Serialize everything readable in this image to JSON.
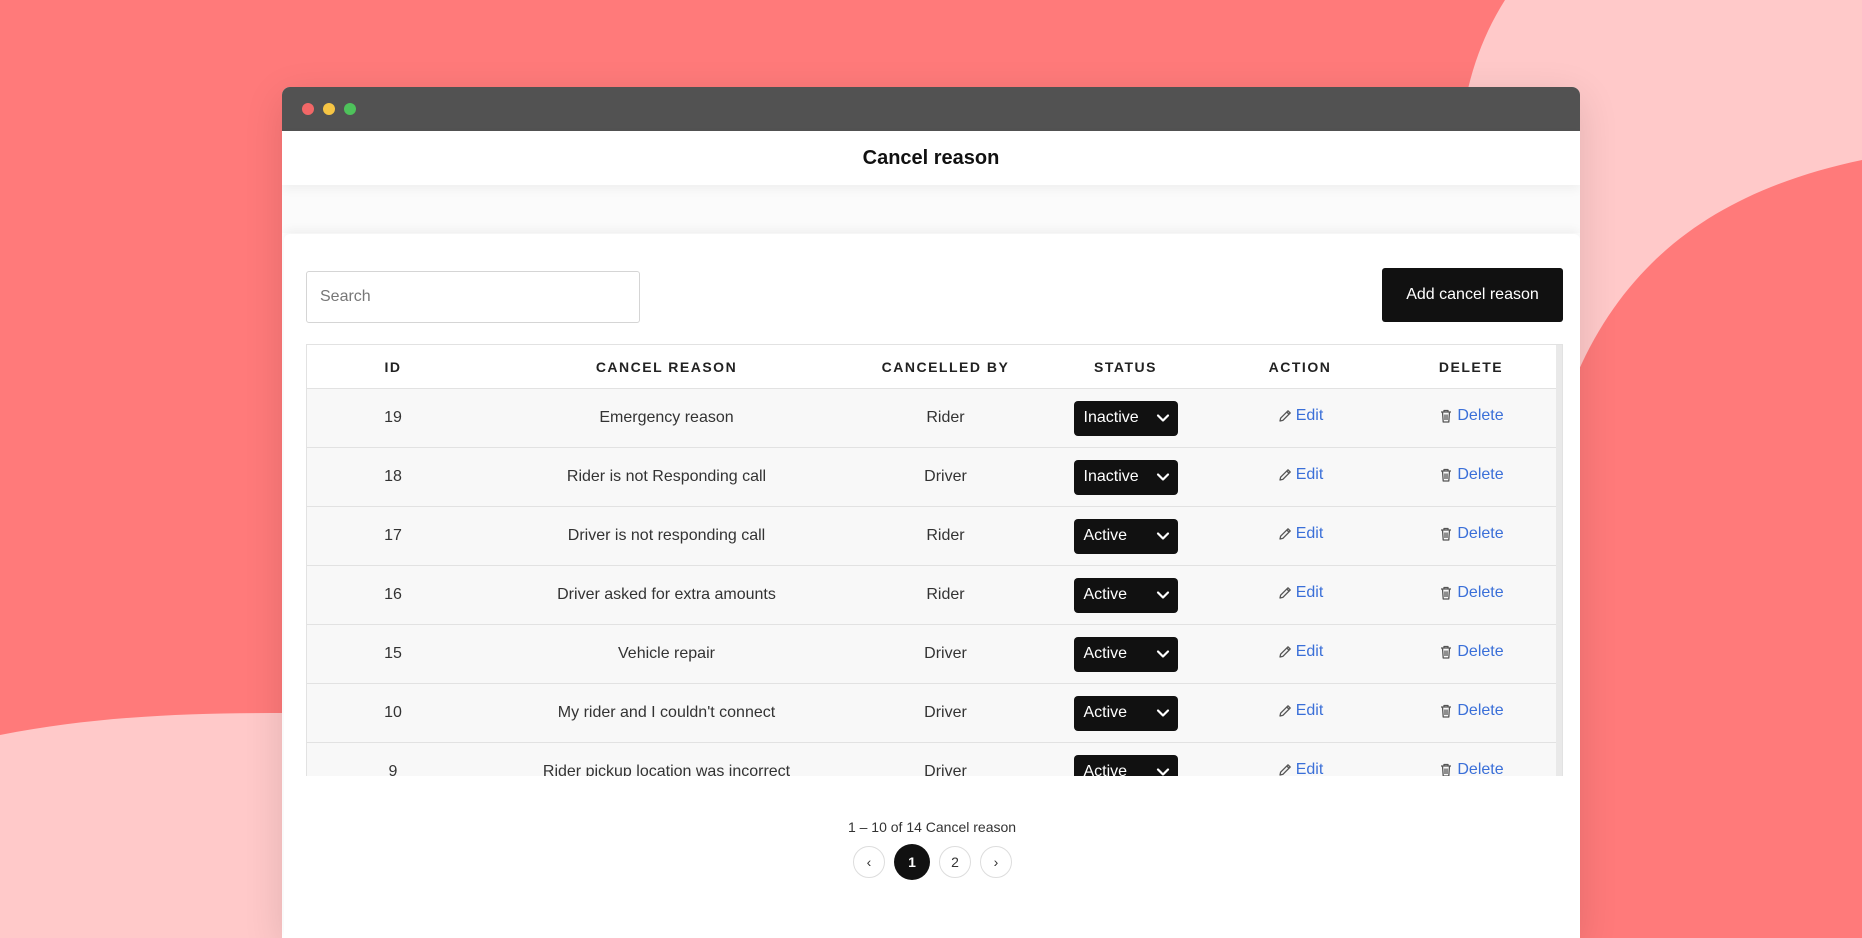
{
  "page": {
    "title": "Cancel reason"
  },
  "search": {
    "placeholder": "Search",
    "value": ""
  },
  "toolbar": {
    "add_label": "Add cancel reason"
  },
  "table": {
    "headers": [
      "ID",
      "CANCEL REASON",
      "CANCELLED BY",
      "STATUS",
      "ACTION",
      "DELETE"
    ],
    "rows": [
      {
        "id": "19",
        "reason": "Emergency reason",
        "by": "Rider",
        "status": "Inactive"
      },
      {
        "id": "18",
        "reason": "Rider is not Responding call",
        "by": "Driver",
        "status": "Inactive"
      },
      {
        "id": "17",
        "reason": "Driver is not responding call",
        "by": "Rider",
        "status": "Active"
      },
      {
        "id": "16",
        "reason": "Driver asked for extra amounts",
        "by": "Rider",
        "status": "Active"
      },
      {
        "id": "15",
        "reason": "Vehicle repair",
        "by": "Driver",
        "status": "Active"
      },
      {
        "id": "10",
        "reason": "My rider and I couldn't connect",
        "by": "Driver",
        "status": "Active"
      },
      {
        "id": "9",
        "reason": "Rider pickup location was incorrect",
        "by": "Driver",
        "status": "Active"
      }
    ],
    "edit_label": "Edit",
    "delete_label": "Delete"
  },
  "pagination": {
    "summary": "1 – 10 of 14 Cancel reason",
    "prev": "‹",
    "next": "›",
    "pages": [
      "1",
      "2"
    ],
    "current": "1"
  },
  "icons": {
    "status_toggle": "chevron-down-icon",
    "edit": "pencil-icon",
    "delete": "trash-icon"
  },
  "colors": {
    "background_primary": "#ff7a7a",
    "background_secondary": "#ffc9c9",
    "titlebar": "#525252",
    "button": "#111111",
    "link": "#3a6fd8"
  }
}
